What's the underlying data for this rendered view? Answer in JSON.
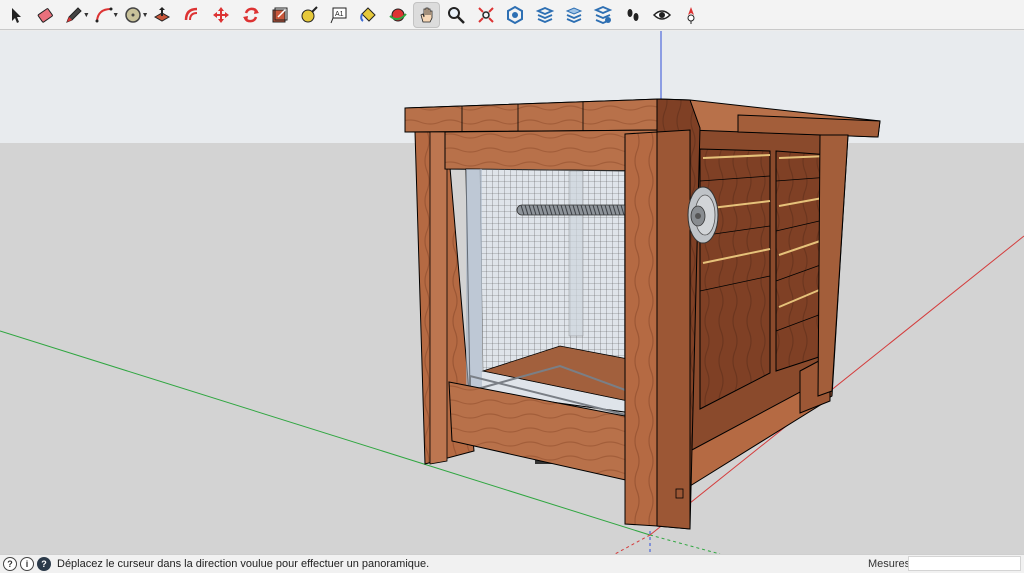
{
  "toolbar": {
    "tools": [
      {
        "name": "select-tool",
        "icon": "arrow-cursor-icon",
        "has_menu": false,
        "active": false
      },
      {
        "name": "eraser-tool",
        "icon": "eraser-icon",
        "has_menu": false,
        "active": false
      },
      {
        "name": "line-tool",
        "icon": "pencil-icon",
        "has_menu": true,
        "active": false
      },
      {
        "name": "arc-tool",
        "icon": "arc-icon",
        "has_menu": true,
        "active": false
      },
      {
        "name": "shapes-tool",
        "icon": "circle-shape-icon",
        "has_menu": true,
        "active": false
      },
      {
        "name": "push-pull-tool",
        "icon": "push-pull-icon",
        "has_menu": false,
        "active": false
      },
      {
        "name": "offset-tool",
        "icon": "offset-icon",
        "has_menu": false,
        "active": false
      },
      {
        "name": "move-tool",
        "icon": "move-arrows-icon",
        "has_menu": false,
        "active": false
      },
      {
        "name": "rotate-tool",
        "icon": "rotate-icon",
        "has_menu": false,
        "active": false
      },
      {
        "name": "scale-tool",
        "icon": "scale-icon",
        "has_menu": false,
        "active": false
      },
      {
        "name": "tape-measure-tool",
        "icon": "tape-measure-icon",
        "has_menu": false,
        "active": false
      },
      {
        "name": "text-tool",
        "icon": "text-label-icon",
        "has_menu": false,
        "active": false
      },
      {
        "name": "paint-bucket-tool",
        "icon": "paint-bucket-icon",
        "has_menu": false,
        "active": false
      },
      {
        "name": "orbit-tool",
        "icon": "orbit-icon",
        "has_menu": false,
        "active": false
      },
      {
        "name": "pan-tool",
        "icon": "hand-icon",
        "has_menu": false,
        "active": true
      },
      {
        "name": "zoom-tool",
        "icon": "magnifier-icon",
        "has_menu": false,
        "active": false
      },
      {
        "name": "zoom-extents-tool",
        "icon": "zoom-extents-icon",
        "has_menu": false,
        "active": false
      },
      {
        "name": "3d-warehouse",
        "icon": "warehouse-icon",
        "has_menu": false,
        "active": false
      },
      {
        "name": "extension-warehouse",
        "icon": "extension-icon",
        "has_menu": false,
        "active": false
      },
      {
        "name": "layers-tool",
        "icon": "layers-icon",
        "has_menu": false,
        "active": false
      },
      {
        "name": "layout-tool",
        "icon": "layout-icon",
        "has_menu": false,
        "active": false
      },
      {
        "name": "walk-tool",
        "icon": "footprints-icon",
        "has_menu": false,
        "active": false
      },
      {
        "name": "look-around-tool",
        "icon": "eye-icon",
        "has_menu": false,
        "active": false
      },
      {
        "name": "position-camera-tool",
        "icon": "position-camera-icon",
        "has_menu": false,
        "active": false
      }
    ]
  },
  "colors": {
    "sky": "#e9ecef",
    "ground": "#d4d4d4",
    "wood": "#b56a43",
    "wood_dark": "#8a4a2c",
    "axis_red": "#d43c3c",
    "axis_green": "#2fa640",
    "axis_blue": "#2f4fd8"
  },
  "status": {
    "message": "Déplacez le curseur dans la direction voulue pour effectuer un panoramique.",
    "measures_label": "Mesures",
    "measures_value": ""
  }
}
